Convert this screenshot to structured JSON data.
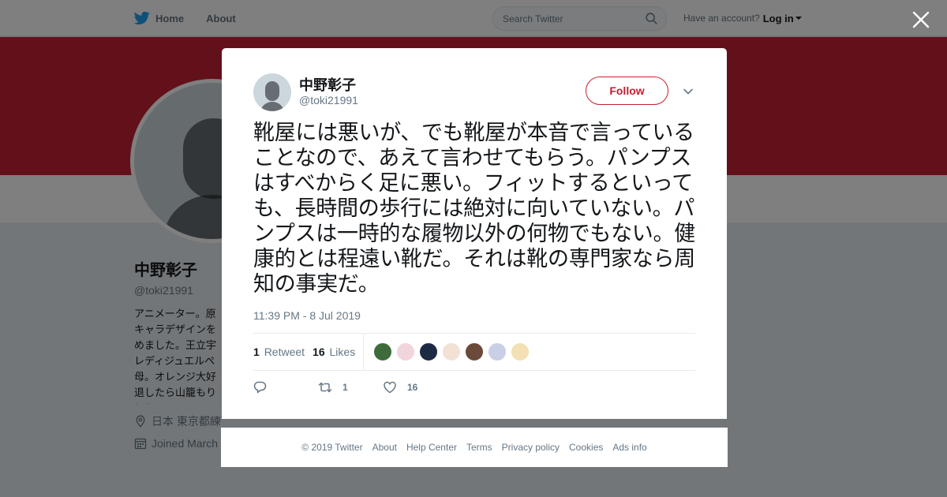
{
  "topbar": {
    "home_label": "Home",
    "about_label": "About",
    "search_placeholder": "Search Twitter",
    "have_account": "Have an account?",
    "login_label": "Log in"
  },
  "profile": {
    "name": "中野彰子",
    "handle": "@toki21991",
    "bio": "アニメーター。原\nキャラデザインを\nめました。王立宇\nレディジュエルペ\n母。オレンジ大好\n退したら山籠もり\nしたい。",
    "location": "日本 東京都練",
    "joined": "Joined March"
  },
  "tweet": {
    "author_name": "中野彰子",
    "author_handle": "@toki21991",
    "follow_label": "Follow",
    "text": "靴屋には悪いが、でも靴屋が本音で言っていることなので、あえて言わせてもらう。パンプスはすべからく足に悪い。フィットするといっても、長時間の歩行には絶対に向いていない。パンプスは一時的な履物以外の何物でもない。健康的とは程遠い靴だ。それは靴の専門家なら周知の事実だ。",
    "timestamp": "11:39 PM - 8 Jul 2019",
    "retweets_count": "1",
    "retweets_label": "Retweet",
    "likes_count": "16",
    "likes_label": "Likes",
    "action_retweet_count": "1",
    "action_like_count": "16"
  },
  "liker_avatar_colors": [
    "#3e6b3a",
    "#f2d5dc",
    "#1d2a44",
    "#f3e1d6",
    "#6b4a3a",
    "#c8cfe6",
    "#f3e0b5"
  ],
  "footer": {
    "links": [
      "© 2019 Twitter",
      "About",
      "Help Center",
      "Terms",
      "Privacy policy",
      "Cookies",
      "Ads info"
    ]
  },
  "colors": {
    "brand_accent": "#c42032",
    "twitter_blue": "#1da1f2"
  }
}
